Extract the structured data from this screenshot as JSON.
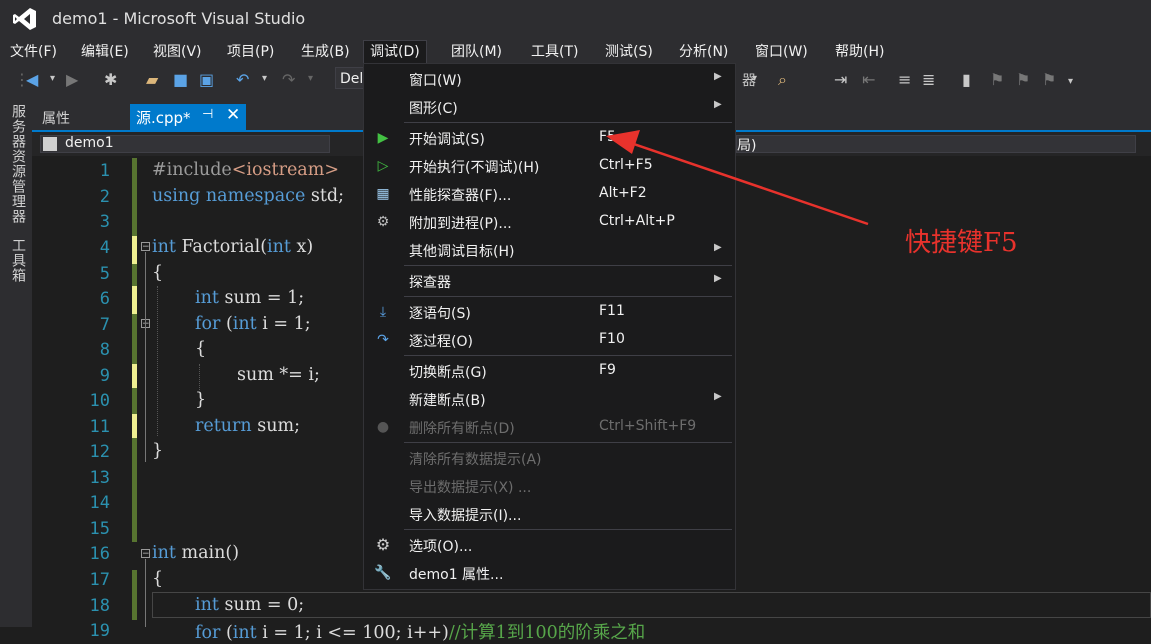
{
  "window": {
    "title": "demo1 - Microsoft Visual Studio"
  },
  "menubar": {
    "items": [
      {
        "label": "文件(F)"
      },
      {
        "label": "编辑(E)"
      },
      {
        "label": "视图(V)"
      },
      {
        "label": "项目(P)"
      },
      {
        "label": "生成(B)"
      },
      {
        "label": "调试(D)"
      },
      {
        "label": "团队(M)"
      },
      {
        "label": "工具(T)"
      },
      {
        "label": "测试(S)"
      },
      {
        "label": "分析(N)"
      },
      {
        "label": "窗口(W)"
      },
      {
        "label": "帮助(H)"
      }
    ]
  },
  "toolbar": {
    "combo_value": "Del"
  },
  "left_strip": {
    "server_explorer": "服务器资源管理器",
    "toolbox": "工具箱"
  },
  "tabs": {
    "properties": "属性",
    "source": "源.cpp*",
    "pin_glyph": "⊣",
    "close_glyph": "✕"
  },
  "navbar": {
    "left": "demo1",
    "right_fragment": "局)"
  },
  "editor": {
    "line_numbers": [
      "1",
      "2",
      "3",
      "4",
      "5",
      "6",
      "7",
      "8",
      "9",
      "10",
      "11",
      "12",
      "13",
      "14",
      "15",
      "16",
      "17",
      "18",
      "19"
    ],
    "lines": {
      "l1_a": "#include",
      "l1_b": "<iostream>",
      "l2_a": "using",
      "l2_b": " ",
      "l2_c": "namespace",
      "l2_d": " std;",
      "l4_a": "int",
      "l4_b": " Factorial(",
      "l4_c": "int",
      "l4_d": " x)",
      "l5": "{",
      "l6_a": "int",
      "l6_b": " sum = 1;",
      "l7_a": "for",
      "l7_b": " (",
      "l7_c": "int",
      "l7_d": " i = 1;",
      "l8": "{",
      "l9": "sum *= i;",
      "l10": "}",
      "l11_a": "return",
      "l11_b": " sum;",
      "l12": "}",
      "l16_a": "int",
      "l16_b": " main()",
      "l17": "{",
      "l18_a": "int",
      "l18_b": " sum = 0;",
      "l19_a": "for",
      "l19_b": " (",
      "l19_c": "int",
      "l19_d": " i = 1; i <= 100; i++)",
      "l19_e": "//计算1到100的阶乘之和"
    }
  },
  "debug_menu": {
    "items": [
      {
        "label": "窗口(W)",
        "shortcut": "",
        "submenu": true
      },
      {
        "label": "图形(C)",
        "shortcut": "",
        "submenu": true
      },
      {
        "label": "开始调试(S)",
        "shortcut": "F5",
        "icon": "play-icon"
      },
      {
        "label": "开始执行(不调试)(H)",
        "shortcut": "Ctrl+F5",
        "icon": "play-outline-icon"
      },
      {
        "label": "性能探查器(F)...",
        "shortcut": "Alt+F2",
        "icon": "performance-icon"
      },
      {
        "label": "附加到进程(P)...",
        "shortcut": "Ctrl+Alt+P",
        "icon": "attach-icon"
      },
      {
        "label": "其他调试目标(H)",
        "shortcut": "",
        "submenu": true
      },
      {
        "label": "探查器",
        "shortcut": "",
        "submenu": true
      },
      {
        "label": "逐语句(S)",
        "shortcut": "F11",
        "icon": "step-into-icon"
      },
      {
        "label": "逐过程(O)",
        "shortcut": "F10",
        "icon": "step-over-icon"
      },
      {
        "label": "切换断点(G)",
        "shortcut": "F9"
      },
      {
        "label": "新建断点(B)",
        "shortcut": "",
        "submenu": true
      },
      {
        "label": "删除所有断点(D)",
        "shortcut": "Ctrl+Shift+F9",
        "disabled": true,
        "icon": "delete-breakpoints-icon"
      },
      {
        "label": "清除所有数据提示(A)",
        "shortcut": "",
        "disabled": true
      },
      {
        "label": "导出数据提示(X) ...",
        "shortcut": "",
        "disabled": true
      },
      {
        "label": "导入数据提示(I)...",
        "shortcut": ""
      },
      {
        "label": "选项(O)...",
        "shortcut": "",
        "icon": "gear-icon"
      },
      {
        "label": "demo1 属性...",
        "shortcut": "",
        "icon": "wrench-icon"
      }
    ]
  },
  "annotation": {
    "text": "快捷键F5",
    "color": "#e8322c"
  },
  "colors": {
    "accent": "#007acc",
    "background": "#1e1e1e",
    "chrome": "#2d2d30",
    "keyword": "#569cd6",
    "line_number": "#2b91af"
  },
  "icons": [
    "vs-logo-icon",
    "back-icon",
    "forward-icon",
    "new-project-icon",
    "open-icon",
    "save-icon",
    "save-all-icon",
    "undo-icon",
    "redo-icon",
    "bookmark-icon"
  ]
}
